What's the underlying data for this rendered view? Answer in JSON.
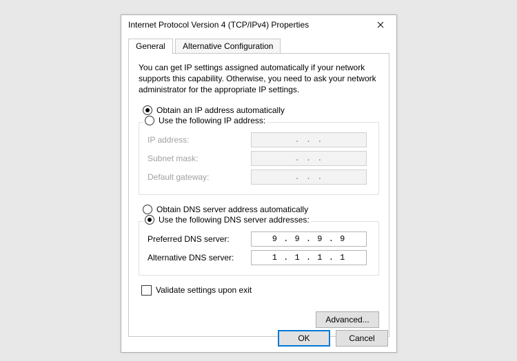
{
  "window": {
    "title": "Internet Protocol Version 4 (TCP/IPv4) Properties"
  },
  "tabs": {
    "general": "General",
    "alt": "Alternative Configuration"
  },
  "intro": "You can get IP settings assigned automatically if your network supports this capability. Otherwise, you need to ask your network administrator for the appropriate IP settings.",
  "ip": {
    "auto_label": "Obtain an IP address automatically",
    "manual_label": "Use the following IP address:",
    "addr_label": "IP address:",
    "mask_label": "Subnet mask:",
    "gw_label": "Default gateway:",
    "addr_value": ".   .   .",
    "mask_value": ".   .   .",
    "gw_value": ".   .   ."
  },
  "dns": {
    "auto_label": "Obtain DNS server address automatically",
    "manual_label": "Use the following DNS server addresses:",
    "pref_label": "Preferred DNS server:",
    "alt_label": "Alternative DNS server:",
    "pref_value": "9 . 9 . 9 . 9",
    "alt_value": "1 . 1 . 1 . 1"
  },
  "validate_label": "Validate settings upon exit",
  "buttons": {
    "advanced": "Advanced...",
    "ok": "OK",
    "cancel": "Cancel"
  }
}
